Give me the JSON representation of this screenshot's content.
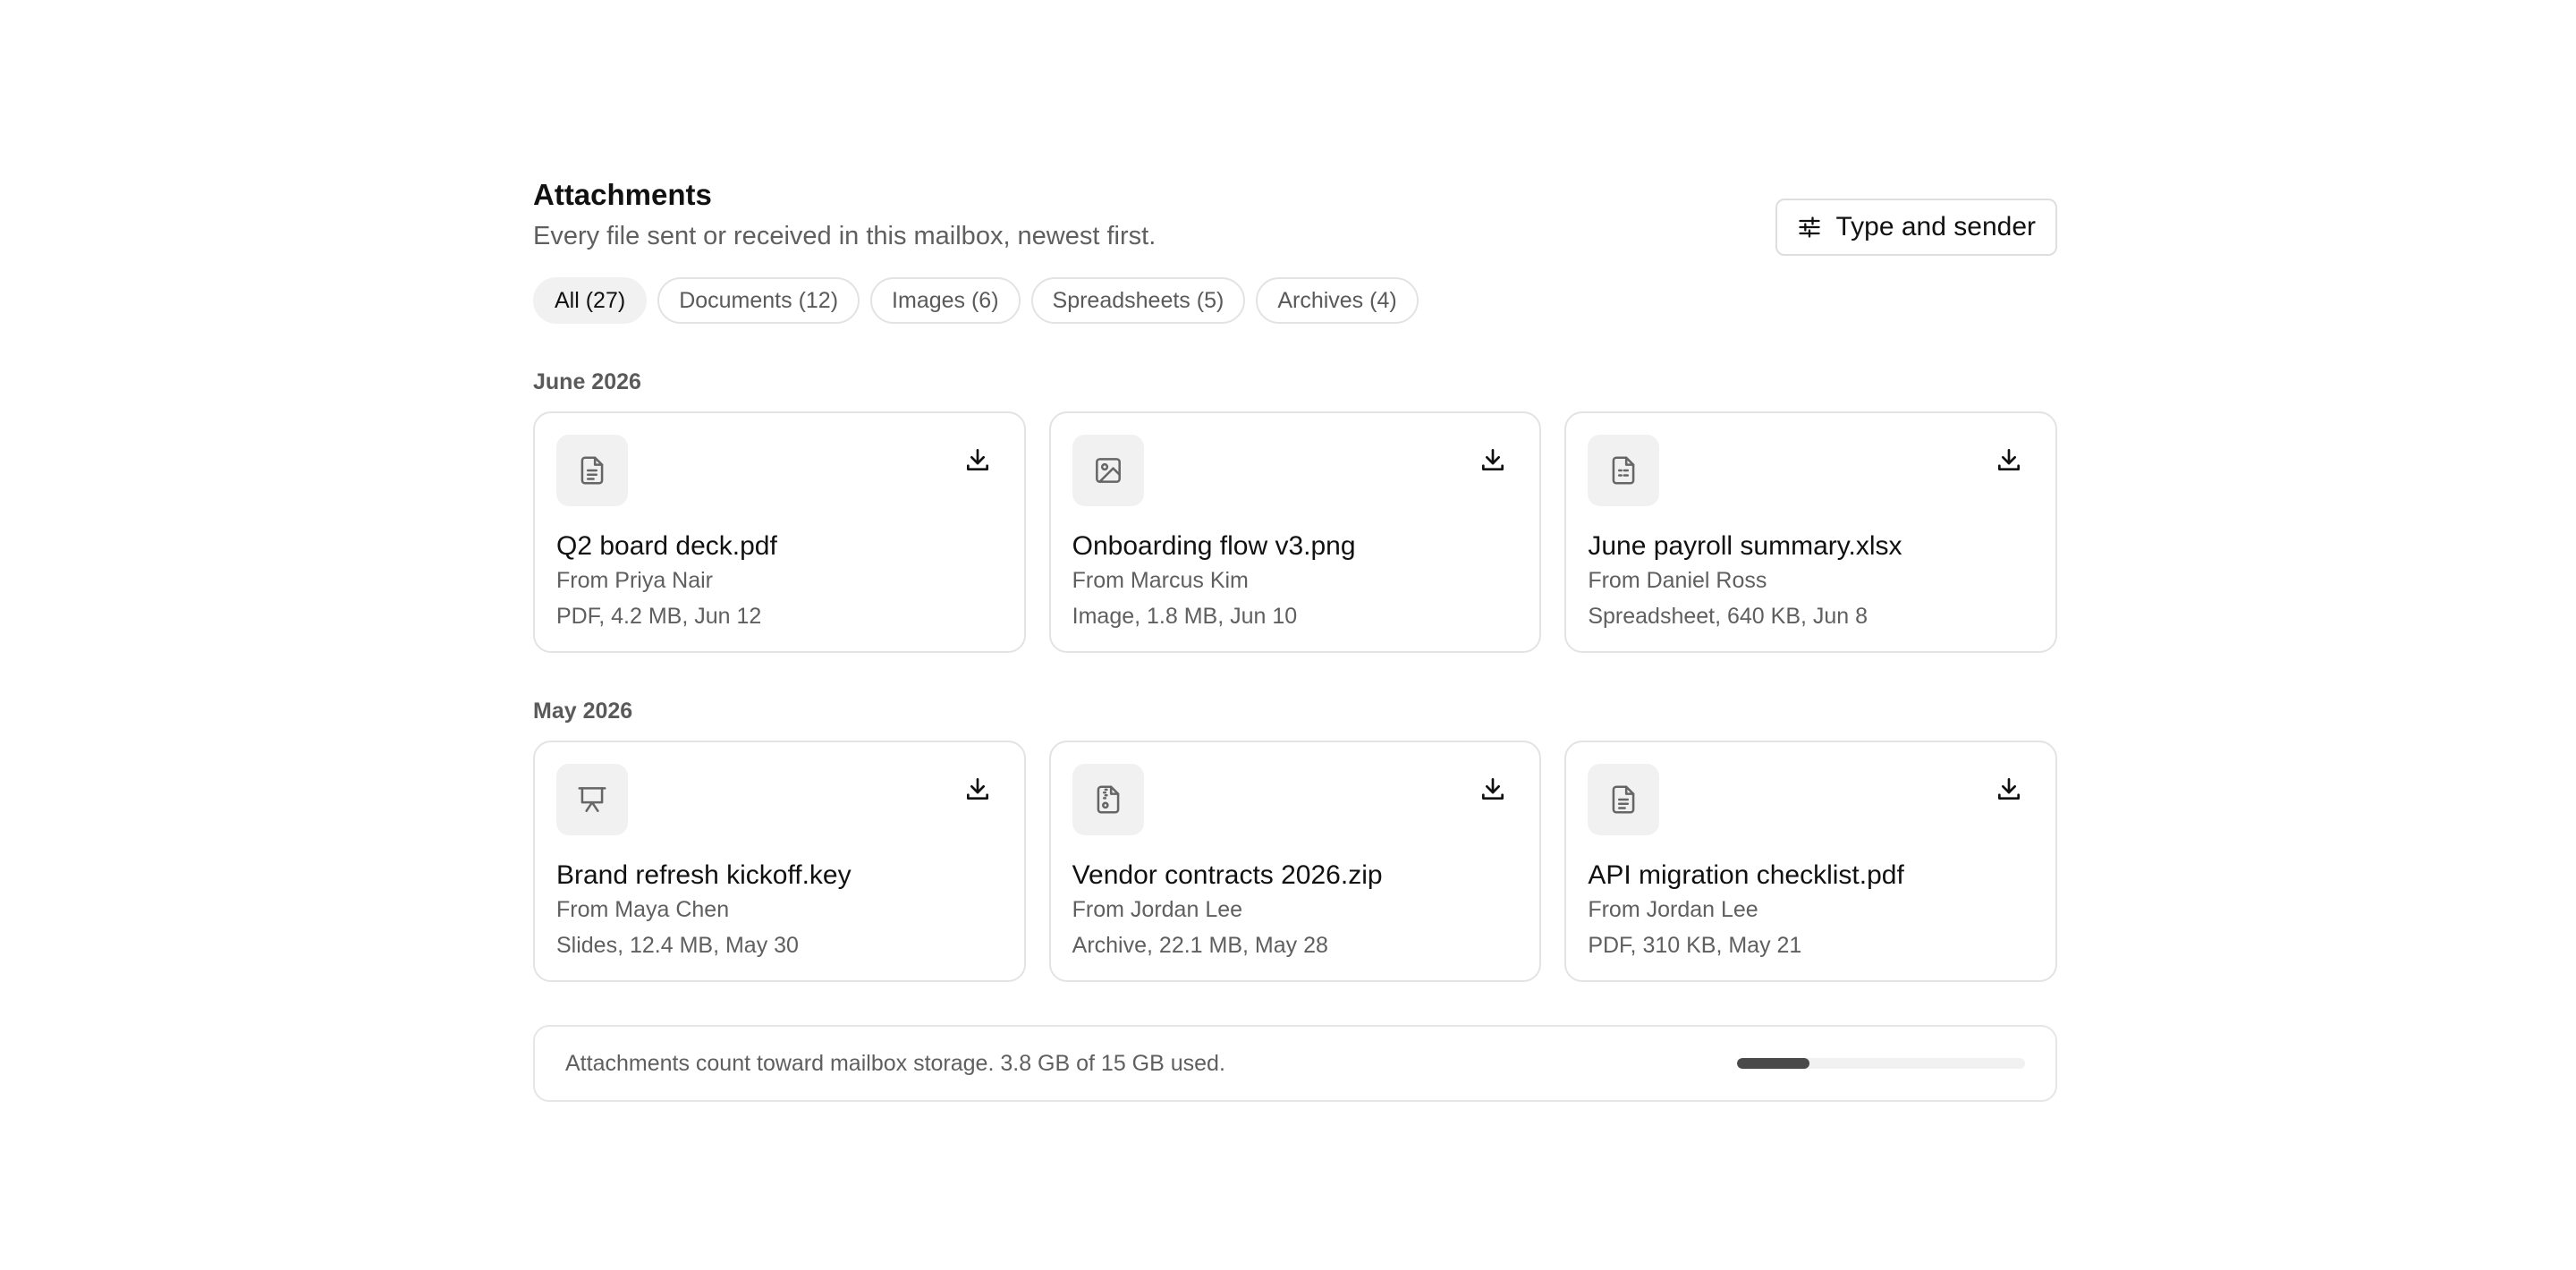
{
  "header": {
    "title": "Attachments",
    "subtitle": "Every file sent or received in this mailbox, newest first.",
    "filter_button": "Type and sender",
    "filter_icon": "sliders-icon"
  },
  "chips": [
    {
      "label": "All (27)",
      "active": true
    },
    {
      "label": "Documents (12)",
      "active": false
    },
    {
      "label": "Images (6)",
      "active": false
    },
    {
      "label": "Spreadsheets (5)",
      "active": false
    },
    {
      "label": "Archives (4)",
      "active": false
    }
  ],
  "sections": [
    {
      "label": "June 2026",
      "files": [
        {
          "name": "Q2 board deck.pdf",
          "from": "From Priya Nair",
          "meta": "PDF, 4.2 MB, Jun 12",
          "icon": "document-icon"
        },
        {
          "name": "Onboarding flow v3.png",
          "from": "From Marcus Kim",
          "meta": "Image, 1.8 MB, Jun 10",
          "icon": "image-icon"
        },
        {
          "name": "June payroll summary.xlsx",
          "from": "From Daniel Ross",
          "meta": "Spreadsheet, 640 KB, Jun 8",
          "icon": "spreadsheet-icon"
        }
      ]
    },
    {
      "label": "May 2026",
      "files": [
        {
          "name": "Brand refresh kickoff.key",
          "from": "From Maya Chen",
          "meta": "Slides, 12.4 MB, May 30",
          "icon": "presentation-icon"
        },
        {
          "name": "Vendor contracts 2026.zip",
          "from": "From Jordan Lee",
          "meta": "Archive, 22.1 MB, May 28",
          "icon": "archive-icon"
        },
        {
          "name": "API migration checklist.pdf",
          "from": "From Jordan Lee",
          "meta": "PDF, 310 KB, May 21",
          "icon": "document-icon"
        }
      ]
    }
  ],
  "storage": {
    "text": "Attachments count toward mailbox storage. 3.8 GB of 15 GB used.",
    "used_fraction": 0.253
  },
  "colors": {
    "accent_bar": "#4a4a4a",
    "chip_active_bg": "#f1f1f1",
    "border": "#e3e3e3"
  }
}
